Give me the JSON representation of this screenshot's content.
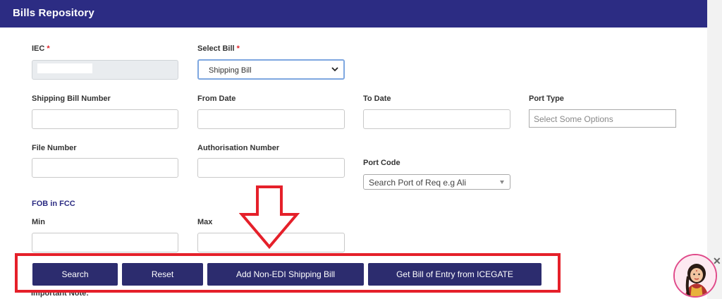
{
  "header": {
    "title": "Bills Repository"
  },
  "form": {
    "iec": {
      "label": "IEC",
      "required_mark": "*"
    },
    "select_bill": {
      "label": "Select Bill",
      "required_mark": "*",
      "value": "Shipping Bill"
    },
    "shipping_bill_number": {
      "label": "Shipping Bill Number"
    },
    "from_date": {
      "label": "From Date"
    },
    "to_date": {
      "label": "To Date"
    },
    "port_type": {
      "label": "Port Type",
      "placeholder": "Select Some Options"
    },
    "file_number": {
      "label": "File Number"
    },
    "authorisation_number": {
      "label": "Authorisation Number"
    },
    "port_code": {
      "label": "Port Code",
      "placeholder": "Search Port of Req e.g Ali"
    },
    "fob_section": {
      "label": "FOB in FCC"
    },
    "min": {
      "label": "Min"
    },
    "max": {
      "label": "Max"
    }
  },
  "actions": {
    "search": "Search",
    "reset": "Reset",
    "add_non_edi": "Add Non-EDI Shipping Bill",
    "get_boe": "Get Bill of Entry from ICEGATE"
  },
  "footer": {
    "important_note": "Important Note:"
  },
  "colors": {
    "header_bg": "#2c2c83",
    "button_bg": "#2c2c6e",
    "annotation_red": "#e5202a"
  },
  "icons": {
    "select_chevron": "chevron-down-icon",
    "combo_arrow": "caret-down-icon",
    "assistant": "assistant-avatar-icon",
    "close": "close-icon",
    "annotation": "down-arrow-annotation"
  }
}
